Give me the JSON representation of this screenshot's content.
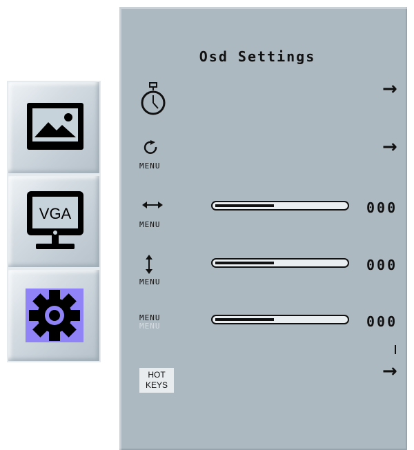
{
  "sidebar": {
    "items": [
      {
        "name": "picture",
        "icon": "picture-icon",
        "selected": false
      },
      {
        "name": "vga-input",
        "icon": "vga-monitor-icon",
        "label": "VGA",
        "selected": false
      },
      {
        "name": "osd-settings",
        "icon": "gear-icon",
        "selected": true
      }
    ],
    "selected_color": "#8f83f7"
  },
  "panel": {
    "title": "Osd Settings",
    "rows": [
      {
        "id": "timeout",
        "icon": "timer-icon",
        "control": "submenu",
        "arrow": "→"
      },
      {
        "id": "rotation",
        "icon": "rotate-icon",
        "menu_label": "MENU",
        "control": "submenu",
        "arrow": "→"
      },
      {
        "id": "h-position",
        "icon": "horizontal-arrows-icon",
        "menu_label": "MENU",
        "control": "slider",
        "level_fraction": 0.45,
        "value_text": "000"
      },
      {
        "id": "v-position",
        "icon": "vertical-arrows-icon",
        "menu_label": "MENU",
        "control": "slider",
        "level_fraction": 0.45,
        "value_text": "000"
      },
      {
        "id": "transparency",
        "icon": "menu-transparency-icon",
        "menu_label": "MENU",
        "menu_label_faded": "MENU",
        "control": "slider",
        "level_fraction": 0.45,
        "value_text": "000"
      },
      {
        "id": "hot-keys",
        "icon": "hotkeys-icon",
        "badge_line1": "HOT",
        "badge_line2": "KEYS",
        "control": "submenu",
        "arrow": "→"
      }
    ]
  }
}
